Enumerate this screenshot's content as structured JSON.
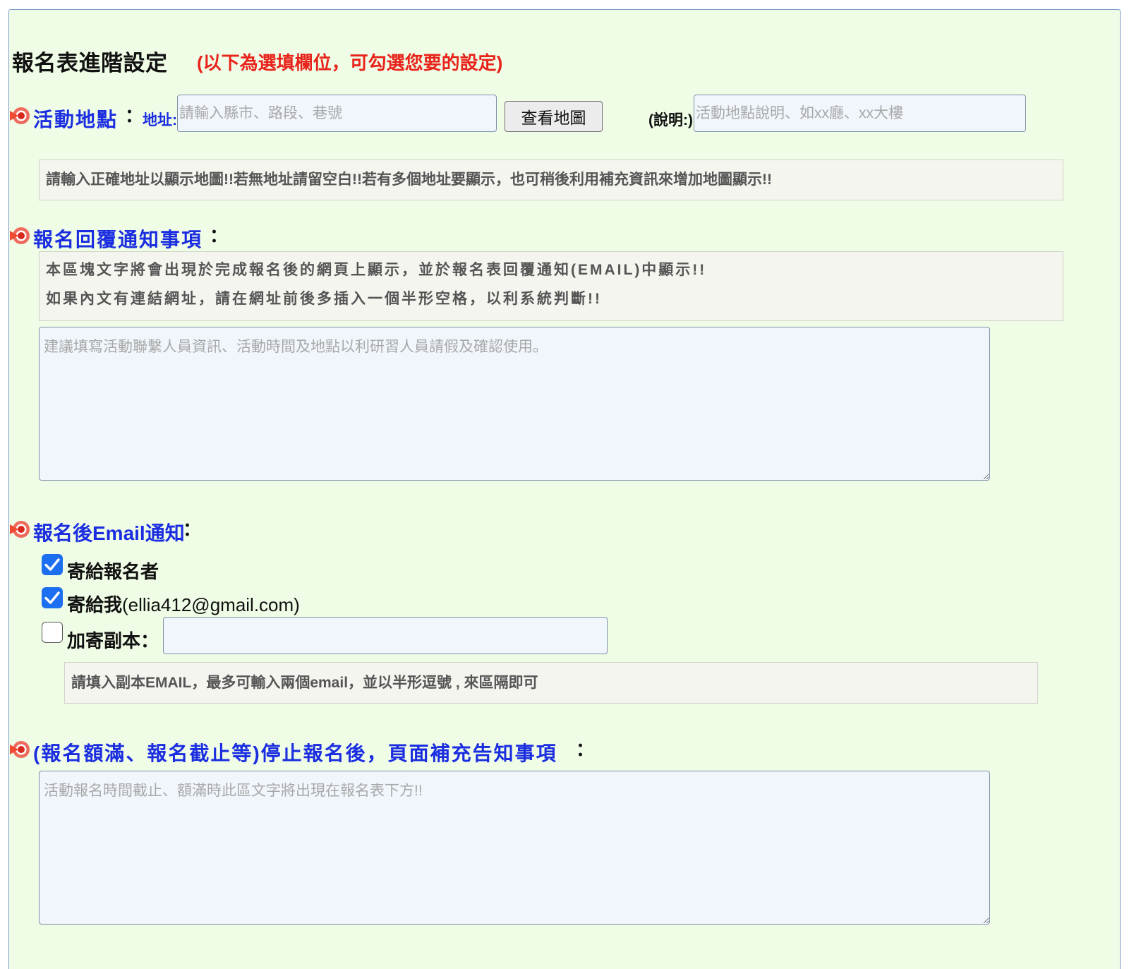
{
  "header": {
    "title": "報名表進階設定",
    "subtitle": "(以下為選填欄位，可勾選您要的設定)"
  },
  "location": {
    "label": "活動地點",
    "colon": "：",
    "address_label": "地址:",
    "address_placeholder": "請輸入縣市、路段、巷號",
    "address_value": "",
    "map_button": "查看地圖",
    "desc_label": "(說明:)",
    "desc_placeholder": "活動地點說明、如xx廳、xx大樓",
    "desc_value": "",
    "note": "請輸入正確地址以顯示地圖!!若無地址請留空白!!若有多個地址要顯示，也可稍後利用補充資訊來增加地圖顯示!!"
  },
  "reply_notice": {
    "label": "報名回覆通知事項",
    "colon": "：",
    "note_lines": [
      "本區塊文字將會出現於完成報名後的網頁上顯示，並於報名表回覆通知(EMAIL)中顯示!!",
      "如果內文有連結網址，請在網址前後多插入一個半形空格，以利系統判斷!!"
    ],
    "textarea_placeholder": "建議填寫活動聯繫人員資訊、活動時間及地點以利研習人員請假及確認使用。",
    "textarea_value": ""
  },
  "email_notify": {
    "label": "報名後Email通知",
    "colon": "：",
    "options": [
      {
        "label": "寄給報名者",
        "checked": true
      },
      {
        "label": "寄給我",
        "email": "(ellia412@gmail.com)",
        "checked": true
      },
      {
        "label": "加寄副本：",
        "checked": false
      }
    ],
    "cc_value": "",
    "cc_note": "請填入副本EMAIL，最多可輸入兩個email，並以半形逗號 , 來區隔即可"
  },
  "closed_notice": {
    "label": "(報名額滿、報名截止等)停止報名後，頁面補充告知事項",
    "colon": "：",
    "textarea_placeholder": "活動報名時間截止、額滿時此區文字將出現在報名表下方!!",
    "textarea_value": ""
  },
  "colors": {
    "panel_bg": "#f0fde6",
    "section_blue": "#1a2de0",
    "subtitle_red": "#e8231b",
    "checkbox_blue": "#1c6ff0"
  }
}
